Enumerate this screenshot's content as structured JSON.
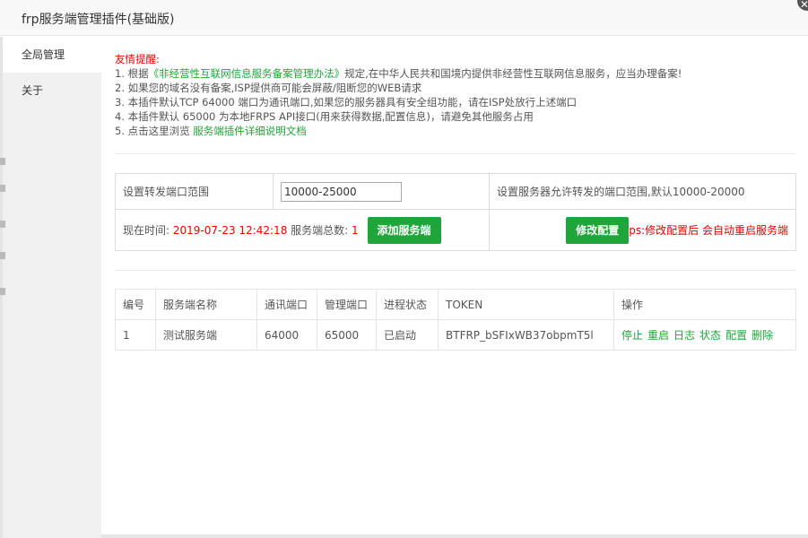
{
  "window": {
    "title": "frp服务端管理插件(基础版)",
    "close_symbol": "✕"
  },
  "sidebar": {
    "items": [
      {
        "label": "全局管理"
      },
      {
        "label": "关于"
      }
    ]
  },
  "notice": {
    "title": "友情提醒:",
    "line1_prefix": "1. 根据",
    "line1_link": "《非经营性互联网信息服务备案管理办法》",
    "line1_suffix": "规定,在中华人民共和国境内提供非经营性互联网信息服务，应当办理备案!",
    "line2": "2. 如果您的域名没有备案,ISP提供商可能会屏蔽/阻断您的WEB请求",
    "line3": "3. 本插件默认TCP 64000 端口为通讯端口,如果您的服务器具有安全组功能，请在ISP处放行上述端口",
    "line4": "4. 本插件默认 65000 为本地FRPS API接口(用来获得数据,配置信息)，请避免其他服务占用",
    "line5_prefix": "5. 点击这里浏览",
    "line5_link": "服务端插件详细说明文档"
  },
  "config": {
    "port_range_label": "设置转发端口范围",
    "port_range_value": "10000-25000",
    "port_range_desc": "设置服务器允许转发的端口范围,默认10000-20000",
    "time_label": "现在时间:",
    "time_value": "2019-07-23 12:42:18",
    "count_label": "服务端总数:",
    "count_value": "1",
    "add_button": "添加服务端",
    "modify_button": "修改配置",
    "ps_note": "ps:修改配置后 会自动重启服务端"
  },
  "table": {
    "headers": [
      "编号",
      "服务端名称",
      "通讯端口",
      "管理端口",
      "进程状态",
      "TOKEN",
      "操作"
    ],
    "rows": [
      {
        "id": "1",
        "name": "测试服务端",
        "comm_port": "64000",
        "mgmt_port": "65000",
        "status": "已启动",
        "token": "BTFRP_bSFIxWB37obpmT5l",
        "ops": [
          "停止",
          "重启",
          "日志",
          "状态",
          "配置",
          "删除"
        ]
      }
    ]
  },
  "colors": {
    "accent_green": "#20a53a",
    "warning_red": "#ef0000"
  }
}
